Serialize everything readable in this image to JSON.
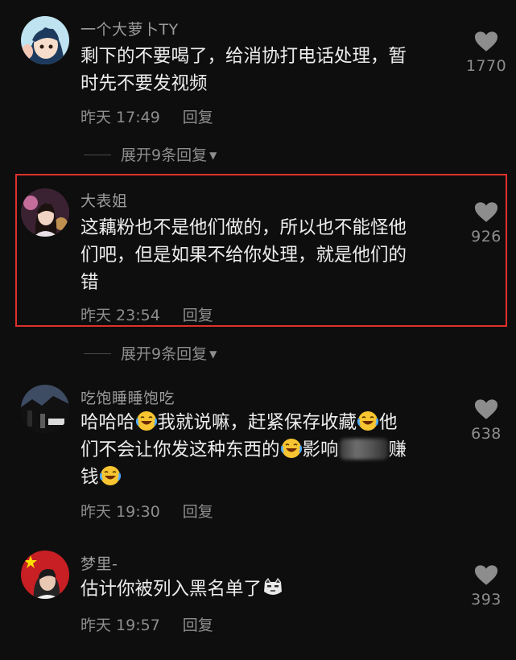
{
  "comments": [
    {
      "username": "一个大萝卜TY",
      "lines": [
        "剩下的不要喝了，给消协打电话处理，暂",
        "时先不要发视频"
      ],
      "time": "昨天 17:49",
      "reply_label": "回复",
      "likes": "1770",
      "expand_label": "展开9条回复",
      "avatar_icon": "cartoon-girl-avatar"
    },
    {
      "username": "大表姐",
      "lines": [
        "这藕粉也不是他们做的，所以也不能怪他",
        "们吧，但是如果不给你处理，就是他们的",
        "错"
      ],
      "time": "昨天 23:54",
      "reply_label": "回复",
      "likes": "926",
      "expand_label": "展开9条回复",
      "highlighted": true,
      "highlight_color": "#e0302c",
      "avatar_icon": "woman-photo-avatar"
    },
    {
      "username": "吃饱睡睡饱吃",
      "line1": [
        "哈哈哈",
        "我就说嘛，赶紧保存收藏",
        "他"
      ],
      "line2": [
        "们不会让你发这种东西的",
        "影响",
        "赚"
      ],
      "line3": [
        "钱"
      ],
      "time": "昨天 19:30",
      "reply_label": "回复",
      "likes": "638",
      "avatar_icon": "dark-street-avatar",
      "emoji_icon": "laughing-tears-emoji"
    },
    {
      "username": "梦里-",
      "lines": [
        "估计你被列入黑名单了"
      ],
      "time": "昨天 19:57",
      "reply_label": "回复",
      "likes": "393",
      "avatar_icon": "man-flag-avatar",
      "emoji_icon": "cat-face-emoji"
    }
  ],
  "colors": {
    "background": "#0e0e0e",
    "text": "#ededed",
    "muted": "#8d8d8d",
    "highlight": "#e0302c"
  }
}
